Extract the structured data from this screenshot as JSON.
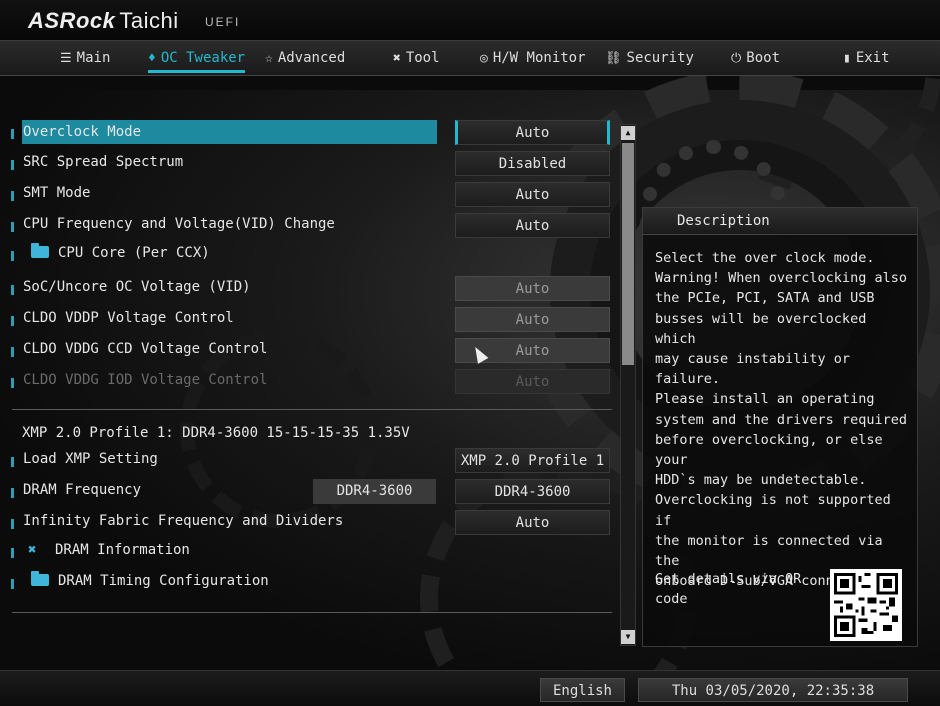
{
  "brand": {
    "name": "ASRock",
    "model": "Taichi",
    "fw": "UEFI"
  },
  "nav": {
    "tabs": [
      {
        "label": "Main",
        "icon": "list-icon"
      },
      {
        "label": "OC Tweaker",
        "icon": "flame-icon",
        "active": true
      },
      {
        "label": "Advanced",
        "icon": "star-icon"
      },
      {
        "label": "Tool",
        "icon": "tools-icon"
      },
      {
        "label": "H/W Monitor",
        "icon": "monitor-icon"
      },
      {
        "label": "Security",
        "icon": "shield-icon"
      },
      {
        "label": "Boot",
        "icon": "power-icon"
      },
      {
        "label": "Exit",
        "icon": "exit-icon"
      }
    ]
  },
  "settings": [
    {
      "label": "Overclock Mode",
      "value": "Auto"
    },
    {
      "label": "SRC Spread Spectrum",
      "value": "Disabled"
    },
    {
      "label": "SMT Mode",
      "value": "Auto"
    },
    {
      "label": "CPU Frequency and Voltage(VID) Change",
      "value": "Auto"
    },
    {
      "label": "CPU Core (Per CCX)"
    },
    {
      "label": "SoC/Uncore OC Voltage (VID)",
      "value": "Auto"
    },
    {
      "label": "CLDO VDDP Voltage Control",
      "value": "Auto"
    },
    {
      "label": "CLDO VDDG CCD Voltage Control",
      "value": "Auto"
    },
    {
      "label": "CLDO VDDG IOD Voltage Control",
      "value": "Auto"
    }
  ],
  "xmp": {
    "profile": "XMP 2.0 Profile 1: DDR4-3600 15-15-15-35 1.35V",
    "rows": [
      {
        "label": "Load XMP Setting",
        "value": "XMP 2.0 Profile 1"
      },
      {
        "label": "DRAM Frequency",
        "current": "DDR4-3600",
        "value": "DDR4-3600"
      },
      {
        "label": "Infinity Fabric Frequency and Dividers",
        "value": "Auto"
      },
      {
        "label": "DRAM Information"
      },
      {
        "label": "DRAM Timing Configuration"
      }
    ]
  },
  "description": {
    "title": "Description",
    "text": "Select the over clock mode.\nWarning! When overclocking also\nthe PCIe, PCI, SATA and USB\nbusses will be overclocked which\nmay cause instability or failure.\nPlease install an operating\nsystem and the drivers required\nbefore overclocking, or else your\nHDD`s may be undetectable.\nOverclocking is not supported if\nthe monitor is connected via the\nonboard D-Sub/VGA connector.",
    "qr_text": "Get details via QR\ncode"
  },
  "footer": {
    "language": "English",
    "datetime": "Thu 03/05/2020, 22:35:38"
  },
  "colors": {
    "accent": "#22b8ce",
    "selected_row": "#1d8aa0",
    "folder": "#3fb6d9"
  }
}
